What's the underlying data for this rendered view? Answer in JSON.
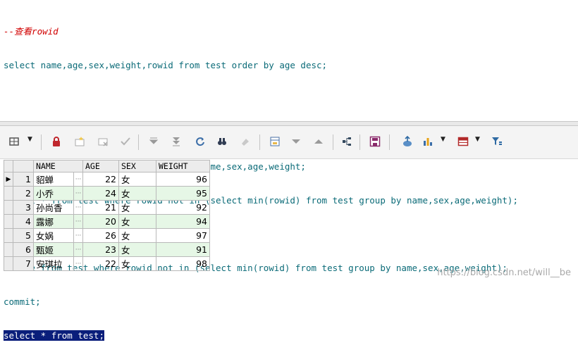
{
  "editor": {
    "lines": [
      "--查看rowid",
      "select name,age,sex,weight,rowid from test order by age desc;",
      "",
      "",
      "select min(rowid) from test group by name,sex,age,weight;",
      "select * from test where rowid not in (select min(rowid) from test group by name,sex,age,weight);",
      "",
      "delete from test where rowid not in (select min(rowid) from test group by name,sex,age,weight);",
      "commit;",
      "select * from test;"
    ],
    "selected_line_index": 9
  },
  "toolbar": {
    "icons": [
      "grid-options-icon",
      "lock-icon",
      "add-record-icon",
      "delete-record-icon",
      "post-changes-icon",
      "next-record-icon",
      "last-record-icon",
      "refresh-icon",
      "find-icon",
      "clear-icon",
      "query-by-example-icon",
      "filter-down-icon",
      "filter-up-icon",
      "link-icon",
      "save-icon",
      "export-icon",
      "chart-icon",
      "table-icon",
      "filter-icon"
    ]
  },
  "grid": {
    "columns": [
      "NAME",
      "AGE",
      "SEX",
      "WEIGHT"
    ],
    "ellipsis": "···",
    "rows": [
      {
        "num": "1",
        "name": "貂蝉",
        "age": "22",
        "sex": "女",
        "weight": "96"
      },
      {
        "num": "2",
        "name": "小乔",
        "age": "24",
        "sex": "女",
        "weight": "95"
      },
      {
        "num": "3",
        "name": "孙尚香",
        "age": "21",
        "sex": "女",
        "weight": "92"
      },
      {
        "num": "4",
        "name": "露娜",
        "age": "20",
        "sex": "女",
        "weight": "94"
      },
      {
        "num": "5",
        "name": "女娲",
        "age": "26",
        "sex": "女",
        "weight": "97"
      },
      {
        "num": "6",
        "name": "甄姬",
        "age": "23",
        "sex": "女",
        "weight": "91"
      },
      {
        "num": "7",
        "name": "安琪拉",
        "age": "22",
        "sex": "女",
        "weight": "98"
      }
    ],
    "current_row_marker": "▶"
  },
  "watermark": "https://blog.csdn.net/will__be",
  "colors": {
    "keyword": "#0b6b78",
    "comment": "#d10000",
    "selection": "#0a1e7b",
    "alt_row": "#e6f7e6"
  }
}
